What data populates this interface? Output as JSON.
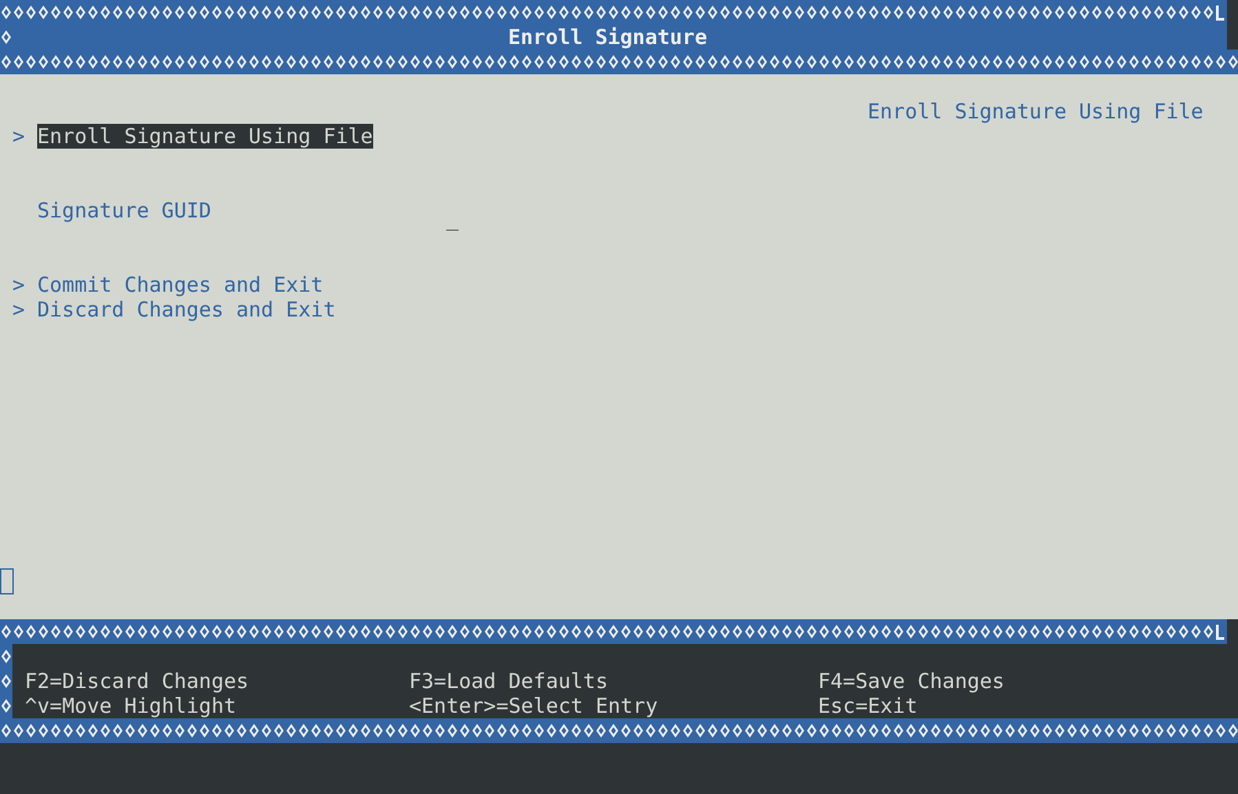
{
  "header": {
    "title": "Enroll Signature"
  },
  "help_text": "Enroll Signature Using File",
  "menu_sections": [
    [
      {
        "kind": "link",
        "marker": ">",
        "label": "Enroll Signature Using File",
        "selected": true
      }
    ],
    [
      {
        "kind": "field",
        "label": "Signature GUID",
        "value": "_",
        "selected": false
      }
    ],
    [
      {
        "kind": "link",
        "marker": ">",
        "label": "Commit Changes and Exit",
        "selected": false
      },
      {
        "kind": "link",
        "marker": ">",
        "label": "Discard Changes and Exit",
        "selected": false
      }
    ]
  ],
  "footer": {
    "rows": [
      [
        "F2=Discard Changes",
        "F3=Load Defaults",
        "F4=Save Changes"
      ],
      [
        "^v=Move Highlight",
        "<Enter>=Select Entry",
        "Esc=Exit"
      ]
    ]
  }
}
